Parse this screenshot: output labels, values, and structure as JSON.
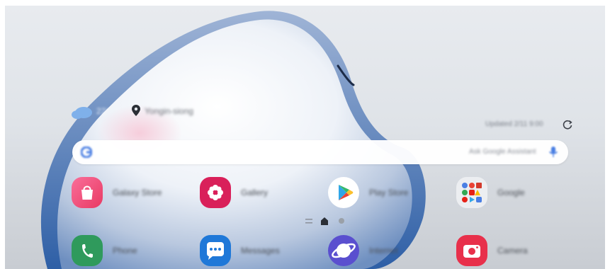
{
  "weather": {
    "temperature": "22°",
    "location": "Yongin-siong",
    "updated": "Updated 2/11 9:00",
    "icon": "cloud-icon"
  },
  "search": {
    "placeholder_hint": "Ask Google Assistant",
    "logo": "google-g-icon",
    "mic": "mic-icon"
  },
  "apps_row1": [
    {
      "name": "Galaxy Store",
      "icon": "shopping-bag-icon",
      "color": "#f24b7a"
    },
    {
      "name": "Gallery",
      "icon": "flower-icon",
      "color": "#d9205a"
    },
    {
      "name": "Play Store",
      "icon": "play-store-icon",
      "color": "#ffffff"
    },
    {
      "name": "Google",
      "icon": "google-folder-icon",
      "color": "#e9eaed"
    }
  ],
  "apps_row2": [
    {
      "name": "Phone",
      "icon": "phone-icon",
      "color": "#2f9a5c"
    },
    {
      "name": "Messages",
      "icon": "chat-bubble-icon",
      "color": "#1f78d8"
    },
    {
      "name": "Internet",
      "icon": "planet-icon",
      "color": "#5a4fcf"
    },
    {
      "name": "Camera",
      "icon": "camera-icon",
      "color": "#e8304b"
    }
  ],
  "page_indicator": {
    "pages": 2,
    "current": "home"
  }
}
